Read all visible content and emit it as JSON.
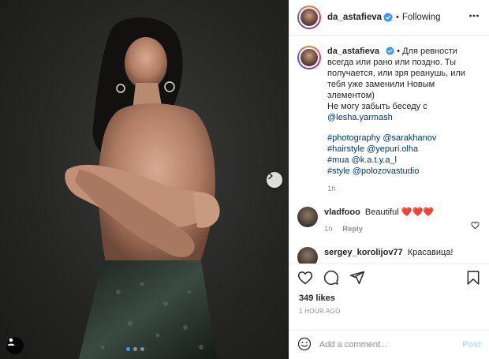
{
  "post": {
    "username": "da_astafieva",
    "verified": true,
    "following_label": "Following",
    "separator": "•",
    "caption": {
      "line1": "Для ревности",
      "line2": "всегда или рано или поздно. Ты",
      "line3": "получается, или зря реанушь, или",
      "line4": "тебя уже заменили Новым",
      "line5": "элементом)",
      "line6": "Не могу забыть беседу с",
      "mention_line": "@lesha.yarmash",
      "credits": [
        "#photography @sarakhanov",
        "#hairstyle @yepuri.olha",
        "#mua @k.a.t.y.a_l",
        "#style @polozovastudio"
      ],
      "time": "1h"
    },
    "comments": [
      {
        "username": "vladfooo",
        "text": "Beautiful ❤️❤️❤️",
        "time": "1h",
        "reply_label": "Reply"
      },
      {
        "username": "sergey_korolijov77",
        "text": "Красавица!"
      }
    ],
    "likes": "349 likes",
    "posted": "1 HOUR AGO",
    "add_comment_placeholder": "Add a comment...",
    "post_button": "Post",
    "carousel": {
      "total": 3,
      "current": 1
    }
  },
  "colors": {
    "link": "#00376b",
    "accent": "#3897f0",
    "muted": "#8e8e8e",
    "post_disabled": "#b2dffc"
  },
  "icons": [
    "verified-badge-icon",
    "more-icon",
    "heart-icon",
    "comment-icon",
    "share-icon",
    "bookmark-icon",
    "emoji-icon",
    "next-arrow-icon",
    "user-tag-icon"
  ]
}
